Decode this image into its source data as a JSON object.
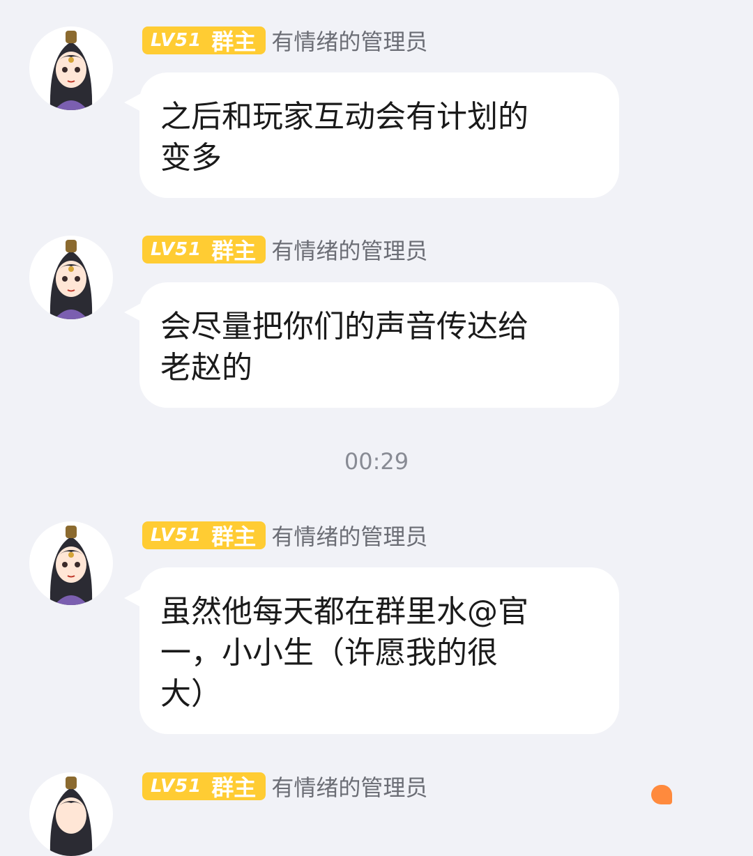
{
  "messages": [
    {
      "level": "LV51",
      "role": "群主",
      "sender": "有情绪的管理员",
      "text": "之后和玩家互动会有计划的\n变多"
    },
    {
      "level": "LV51",
      "role": "群主",
      "sender": "有情绪的管理员",
      "text": "会尽量把你们的声音传达给\n老赵的"
    },
    {
      "level": "LV51",
      "role": "群主",
      "sender": "有情绪的管理员",
      "text": "虽然他每天都在群里水@官\n一，小小生（许愿我的很\n大）"
    },
    {
      "level": "LV51",
      "role": "群主",
      "sender": "有情绪的管理员",
      "text": ""
    }
  ],
  "timestamp": "00:29",
  "colors": {
    "background": "#f1f2f7",
    "badge": "#ffcc33",
    "bubble": "#ffffff",
    "sender": "#6b6d75",
    "floating_icon": "#ff8a3d"
  },
  "icons": {
    "avatar": "anime-girl-avatar",
    "floating": "orange-heart-icon"
  }
}
